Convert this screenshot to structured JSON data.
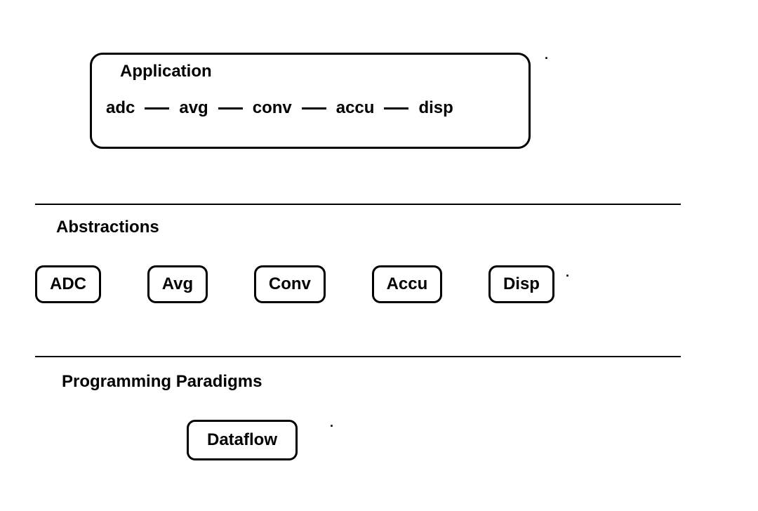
{
  "application": {
    "title": "Application",
    "pipeline": [
      "adc",
      "avg",
      "conv",
      "accu",
      "disp"
    ]
  },
  "abstractions": {
    "title": "Abstractions",
    "items": [
      "ADC",
      "Avg",
      "Conv",
      "Accu",
      "Disp"
    ]
  },
  "paradigms": {
    "title": "Programming Paradigms",
    "items": [
      "Dataflow"
    ]
  },
  "dots": [
    ".",
    ".",
    "."
  ]
}
